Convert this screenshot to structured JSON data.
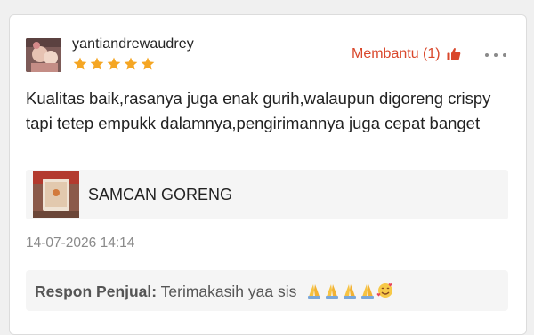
{
  "review": {
    "username": "yantiandrewaudrey",
    "rating": 5,
    "rating_max": 5,
    "helpful_label": "Membantu (1)",
    "text": "Kualitas baik,rasanya juga enak gurih,walaupun digoreng crispy tapi tetep empukk dalamnya,pengirimannya juga cepat banget",
    "date": "14-07-2026 14:14"
  },
  "product": {
    "name": "SAMCAN GORENG"
  },
  "seller_response": {
    "label": "Respon Penjual:",
    "text": "Terimakasih yaa sis",
    "emojis": [
      "folded-hands-icon",
      "folded-hands-icon",
      "folded-hands-icon",
      "folded-hands-icon",
      "smiling-face-with-hearts-icon"
    ]
  },
  "colors": {
    "accent": "#d9472b",
    "star": "#f5a623",
    "panel_bg": "#f5f5f5"
  },
  "icons": {
    "avatar": "user-avatar-photo",
    "helpful": "thumbs-up-icon",
    "more": "more-horizontal-icon",
    "star": "star-icon"
  }
}
